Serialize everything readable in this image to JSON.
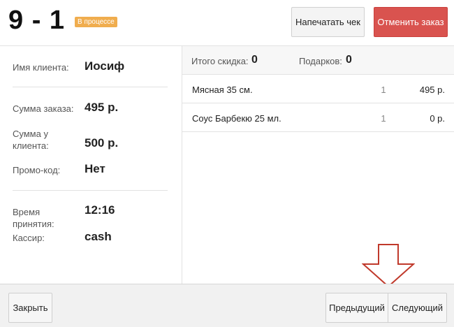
{
  "header": {
    "order_number": "9 - 1",
    "status": "В процессе",
    "print_receipt_label": "Напечатать чек",
    "cancel_order_label": "Отменить заказ"
  },
  "order_info": {
    "client_name_label": "Имя клиента:",
    "client_name": "Иосиф",
    "order_sum_label": "Сумма заказа:",
    "order_sum": "495 р.",
    "client_sum_label": "Сумма у клиента:",
    "client_sum": "500 р.",
    "promo_label": "Промо-код:",
    "promo": "Нет",
    "accepted_time_label": "Время принятия:",
    "accepted_time": "12:16",
    "cashier_label": "Кассир:",
    "cashier": "cash"
  },
  "summary": {
    "discount_label": "Итого скидка:",
    "discount": "0",
    "gifts_label": "Подарков:",
    "gifts": "0"
  },
  "items": [
    {
      "name": "Мясная 35 см.",
      "qty": "1",
      "price": "495 р."
    },
    {
      "name": "Соус Барбекю 25 мл.",
      "qty": "1",
      "price": "0 р."
    }
  ],
  "footer": {
    "close_label": "Закрыть",
    "prev_label": "Предыдущий",
    "next_label": "Следующий"
  },
  "colors": {
    "status_badge": "#f0ad4e",
    "cancel_button": "#d9534f",
    "annotation_arrow": "#c0392b"
  },
  "annotation": {
    "icon": "down-arrow-icon"
  }
}
